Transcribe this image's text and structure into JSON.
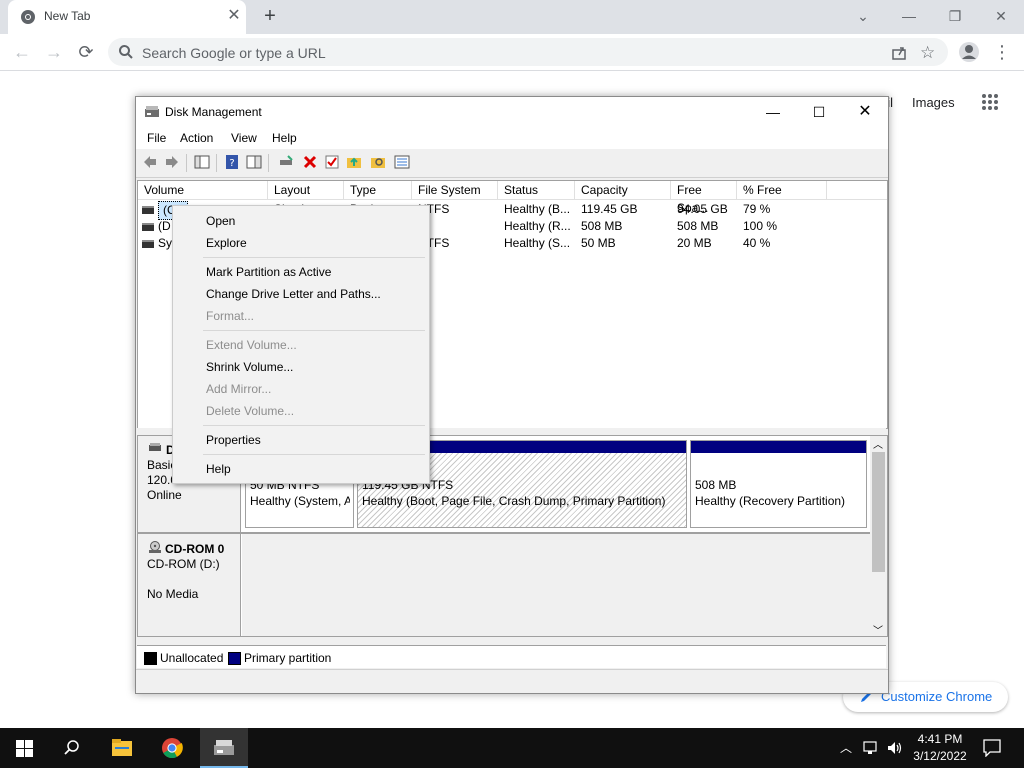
{
  "chrome": {
    "tab_title": "New Tab",
    "omnibox_placeholder": "Search Google or type a URL",
    "ntp_gmail": "ail",
    "ntp_images": "Images",
    "customize_label": "Customize Chrome"
  },
  "dm": {
    "title": "Disk Management",
    "menu": [
      "File",
      "Action",
      "View",
      "Help"
    ],
    "columns": [
      "Volume",
      "Layout",
      "Type",
      "File System",
      "Status",
      "Capacity",
      "Free Spa...",
      "% Free"
    ],
    "rows": [
      {
        "volume": "(C:)",
        "layout": "Simple",
        "type": "Basic",
        "fs": "NTFS",
        "status": "Healthy (B...",
        "capacity": "119.45 GB",
        "free": "94.05 GB",
        "pct": "79 %"
      },
      {
        "volume": "(D",
        "layout": "",
        "type": "",
        "fs": "",
        "status": "Healthy (R...",
        "capacity": "508 MB",
        "free": "508 MB",
        "pct": "100 %"
      },
      {
        "volume": "Sy",
        "layout": "",
        "type": "",
        "fs": "NTFS",
        "status": "Healthy (S...",
        "capacity": "50 MB",
        "free": "20 MB",
        "pct": "40 %"
      }
    ],
    "disk0": {
      "name": "D",
      "type": "Basic",
      "size": "120.00 GB",
      "state": "Online",
      "partitions": [
        {
          "line1": "50 MB NTFS",
          "line2": "Healthy (System, A"
        },
        {
          "line1": "119.45 GB NTFS",
          "line2": "Healthy (Boot, Page File, Crash Dump, Primary Partition)"
        },
        {
          "line1": "508 MB",
          "line2": "Healthy (Recovery Partition)"
        }
      ]
    },
    "cdrom": {
      "name": "CD-ROM 0",
      "drive": "CD-ROM (D:)",
      "state": "No Media"
    },
    "legend": [
      "Unallocated",
      "Primary partition"
    ],
    "colors": {
      "unallocated": "#000000",
      "primary": "#000080"
    }
  },
  "context_menu": {
    "items": [
      {
        "label": "Open",
        "enabled": true
      },
      {
        "label": "Explore",
        "enabled": true
      },
      {
        "label": "Mark Partition as Active",
        "enabled": true
      },
      {
        "label": "Change Drive Letter and Paths...",
        "enabled": true
      },
      {
        "label": "Format...",
        "enabled": false
      },
      {
        "label": "Extend Volume...",
        "enabled": false
      },
      {
        "label": "Shrink Volume...",
        "enabled": true
      },
      {
        "label": "Add Mirror...",
        "enabled": false
      },
      {
        "label": "Delete Volume...",
        "enabled": false
      },
      {
        "label": "Properties",
        "enabled": true
      },
      {
        "label": "Help",
        "enabled": true
      }
    ]
  },
  "taskbar": {
    "time": "4:41 PM",
    "date": "3/12/2022"
  }
}
